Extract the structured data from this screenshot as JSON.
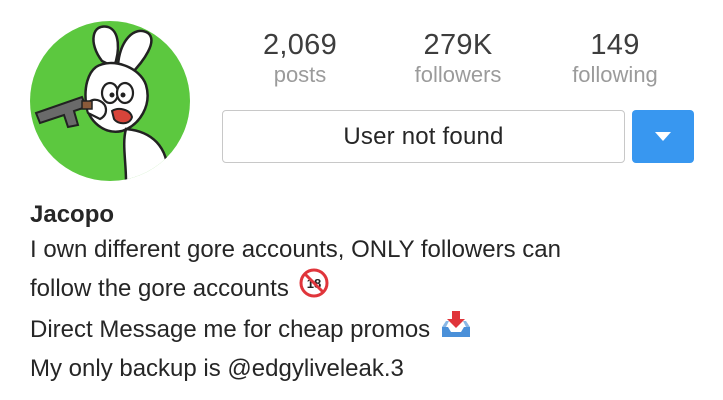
{
  "profile": {
    "avatar_icon": "cartoon-rabbit-with-gun-avatar",
    "avatar_bg_color": "#5cc83f",
    "stats": [
      {
        "value": "2,069",
        "label": "posts"
      },
      {
        "value": "279K",
        "label": "followers"
      },
      {
        "value": "149",
        "label": "following"
      }
    ],
    "status_button_label": "User not found",
    "dropdown_icon": "chevron-down-icon",
    "accent_color": "#3897f0"
  },
  "bio": {
    "name": "Jacopo",
    "line1": "I own different gore accounts, ONLY followers can",
    "line2": "follow the gore accounts",
    "line2_emoji": "no-one-under-eighteen-icon",
    "line3": "Direct Message me for cheap promos",
    "line3_emoji": "inbox-tray-icon",
    "line4": "My only backup is @edgyliveleak.3"
  }
}
